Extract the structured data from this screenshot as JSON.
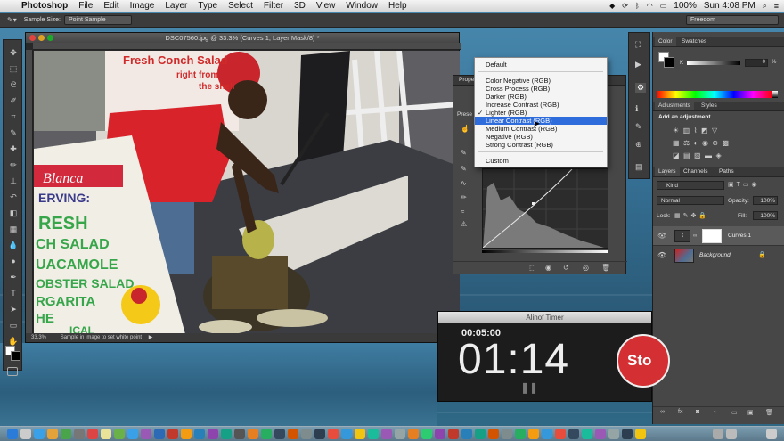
{
  "menubar": {
    "apple_glyph": "",
    "app": "Photoshop",
    "items": [
      "File",
      "Edit",
      "Image",
      "Layer",
      "Type",
      "Select",
      "Filter",
      "3D",
      "View",
      "Window",
      "Help"
    ],
    "battery": "100%",
    "clock": "Sun 4:08 PM"
  },
  "options_bar": {
    "sample_size_label": "Sample Size:",
    "sample_size_value": "Point Sample",
    "workspace": "Freedom"
  },
  "document": {
    "title": "DSC07560.jpg @ 33.3% (Curves 1, Layer Mask/8) *",
    "zoom": "33.3%",
    "status_hint": "Sample in image to set white point",
    "sign_text": [
      "Fresh Conch Salad",
      "right from",
      "the shell",
      "Blanca",
      "ERVING:",
      "RESH",
      "CH SALAD",
      "UACAMOLE",
      "OBSTER SALAD",
      "RGARITA",
      "HE",
      "ICAL"
    ]
  },
  "properties": {
    "tab": "Propert",
    "preset_label": "Prese",
    "preset_menu": {
      "items": [
        {
          "label": "Default"
        },
        {
          "label": "Color Negative (RGB)"
        },
        {
          "label": "Cross Process (RGB)"
        },
        {
          "label": "Darker (RGB)"
        },
        {
          "label": "Increase Contrast (RGB)"
        },
        {
          "label": "Lighter (RGB)",
          "checked": true
        },
        {
          "label": "Linear Contrast (RGB)",
          "highlighted": true
        },
        {
          "label": "Medium Contrast (RGB)"
        },
        {
          "label": "Negative (RGB)"
        },
        {
          "label": "Strong Contrast (RGB)"
        },
        {
          "label": "Custom"
        }
      ]
    }
  },
  "panels": {
    "color_tabs": [
      "Color",
      "Swatches"
    ],
    "k_label": "K",
    "k_value": "0",
    "k_unit": "%",
    "adjust_tabs": [
      "Adjustments",
      "Styles"
    ],
    "adjust_header": "Add an adjustment",
    "layer_tabs": [
      "Layers",
      "Channels",
      "Paths"
    ],
    "kind": "Kind",
    "blend_mode": "Normal",
    "opacity_label": "Opacity:",
    "opacity": "100%",
    "lock_label": "Lock:",
    "fill_label": "Fill:",
    "fill": "100%",
    "layers": [
      {
        "name": "Curves 1"
      },
      {
        "name": "Background",
        "italic": true,
        "locked": true
      }
    ]
  },
  "timer": {
    "title": "Alinof Timer",
    "small": "00:05:00",
    "big": "01:14",
    "stop_label": "Sto"
  },
  "colors": {
    "menu_highlight": "#2f6cdb",
    "shirt_red": "#d8232a",
    "stop_red": "#d43033",
    "sign_green": "#37a64a"
  }
}
